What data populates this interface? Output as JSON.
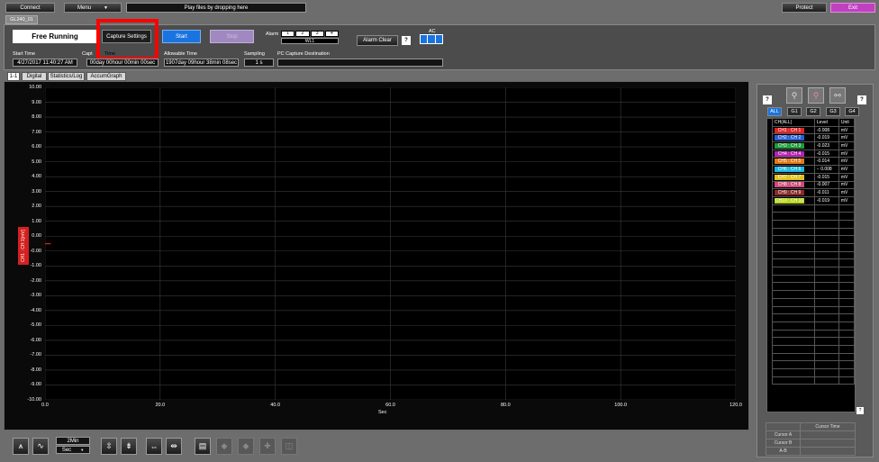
{
  "topbar": {
    "connect": "Connect",
    "menu": "Menu",
    "play_files": "Play files by dropping here",
    "protect": "Protect",
    "exit": "Exit"
  },
  "device_tab": "GL240_01",
  "status": "Free Running",
  "buttons": {
    "capture_settings": "Capture Settings",
    "start": "Start",
    "stop": "Stop",
    "alarm_clear": "Alarm Clear",
    "help": "?"
  },
  "alarm": {
    "label": "Alarm",
    "slots": [
      "1",
      "2",
      "3",
      "4"
    ],
    "wl": "WL1"
  },
  "ac_label": "AC",
  "info": {
    "start_time_label": "Start Time",
    "start_time": "4/27/2017 11:40:27 AM",
    "capture_time_label": "Capt",
    "capture_time_label_tail": "Time",
    "capture_time": "00day 00hour 00min 00sec",
    "allowable_time_label": "Allowable Time",
    "allowable_time": "1907day 09hour 38min 08sec",
    "sampling_label": "Sampling",
    "sampling": "1 s",
    "pc_dest_label": "PC Capture Destination",
    "pc_dest": ""
  },
  "view_tabs": [
    "1-1",
    "Digital",
    "Statistics/Log",
    "AccumGraph"
  ],
  "chart_data": {
    "type": "line",
    "ylabel": "CH1 : CH 1[mV]",
    "xlabel": "Sec",
    "y_ticks": [
      "10.00",
      "9.00",
      "8.00",
      "7.00",
      "6.00",
      "5.00",
      "4.00",
      "3.00",
      "2.00",
      "1.00",
      "0.00",
      "-0.00",
      "-1.00",
      "-2.00",
      "-3.00",
      "-4.00",
      "-5.00",
      "-6.00",
      "-7.00",
      "-8.00",
      "-9.00",
      "-10.00"
    ],
    "x_ticks": [
      "0.0",
      "20.0",
      "40.0",
      "60.0",
      "80.0",
      "100.0",
      "120.0"
    ],
    "xlim": [
      0,
      120
    ],
    "ylim": [
      -10,
      10
    ],
    "grid": true,
    "series": [
      {
        "name": "CH1 : CH 1[mV]",
        "color": "#e02424",
        "x": [
          0,
          1
        ],
        "y": [
          -0.008,
          -0.008
        ]
      }
    ]
  },
  "bottom": {
    "time_value": "2Min",
    "time_unit": "Sec"
  },
  "right_panel": {
    "help": "?",
    "groups": [
      "ALL",
      "G1",
      "G2",
      "G3",
      "G4"
    ],
    "headers": [
      "CH(ALL)",
      "Level",
      "Unit"
    ],
    "channels": [
      {
        "name": "CH1 : CH 1",
        "level": "-0.008",
        "unit": "mV",
        "color": "#e02424"
      },
      {
        "name": "CH2 : CH 2",
        "level": "-0.019",
        "unit": "mV",
        "color": "#2a5fd4"
      },
      {
        "name": "CH3 : CH 3",
        "level": "-0.023",
        "unit": "mV",
        "color": "#1f9a3a"
      },
      {
        "name": "CH4 : CH 4",
        "level": "-0.015",
        "unit": "mV",
        "color": "#b321b3"
      },
      {
        "name": "CH5 : CH 5",
        "level": "-0.014",
        "unit": "mV",
        "color": "#e07a18"
      },
      {
        "name": "CH6 : CH 6",
        "level": "− 0.008",
        "unit": "mV",
        "color": "#1fb8e0"
      },
      {
        "name": "CH7 : CH 7",
        "level": "-0.015",
        "unit": "mV",
        "color": "#e0c21f"
      },
      {
        "name": "CH8 : CH 8",
        "level": "-0.007",
        "unit": "mV",
        "color": "#d44a7a"
      },
      {
        "name": "CH9 : CH 9",
        "level": "-0.011",
        "unit": "mV",
        "color": "#8a2a2a"
      },
      {
        "name": "CH10 : CH 10",
        "level": "-0.019",
        "unit": "mV",
        "color": "#b8d41f"
      }
    ],
    "cursor": {
      "header": "Cursor Time",
      "rows": [
        "Cursor A",
        "Cursor B",
        "A-B"
      ]
    }
  },
  "highlight_color": "#ff0000"
}
